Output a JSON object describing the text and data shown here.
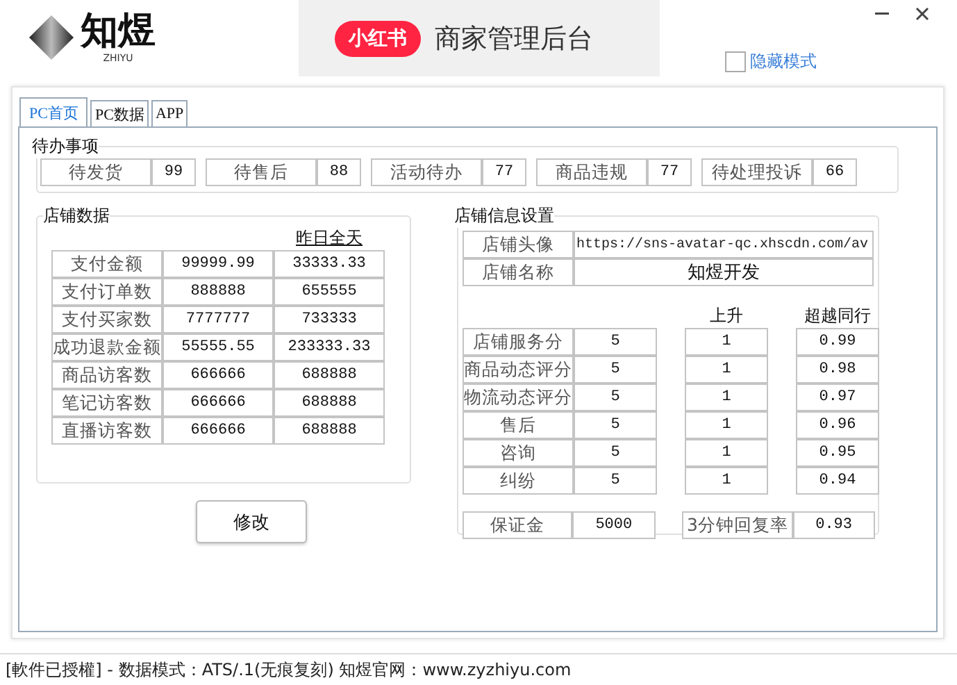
{
  "header": {
    "logo_text": "知煜",
    "logo_sub": "ZHIYU",
    "banner_badge": "小红书",
    "banner_title": "商家管理后台",
    "hide_mode": {
      "label": "隐藏模式",
      "checked": false
    }
  },
  "tabs": [
    {
      "label": "PC首页",
      "selected": true
    },
    {
      "label": "PC数据",
      "selected": false
    },
    {
      "label": "APP",
      "selected": false
    }
  ],
  "todo": {
    "title": "待办事项",
    "items": [
      {
        "label": "待发货",
        "count": "99"
      },
      {
        "label": "待售后",
        "count": "88"
      },
      {
        "label": "活动待办",
        "count": "77"
      },
      {
        "label": "商品违规",
        "count": "77"
      },
      {
        "label": "待处理投诉",
        "count": "66"
      }
    ]
  },
  "store_data": {
    "title": "店铺数据",
    "column_header": "昨日全天",
    "rows": [
      [
        "支付金额",
        "99999.99",
        "33333.33"
      ],
      [
        "支付订单数",
        "888888",
        "655555"
      ],
      [
        "支付买家数",
        "7777777",
        "733333"
      ],
      [
        "成功退款金额",
        "55555.55",
        "233333.33"
      ],
      [
        "商品访客数",
        "666666",
        "688888"
      ],
      [
        "笔记访客数",
        "666666",
        "688888"
      ],
      [
        "直播访客数",
        "666666",
        "688888"
      ]
    ]
  },
  "store_info": {
    "title": "店铺信息设置",
    "avatar": {
      "label": "店铺头像",
      "value": "https://sns-avatar-qc.xhscdn.com/av"
    },
    "name": {
      "label": "店铺名称",
      "value": "知煜开发"
    },
    "headers": [
      "上升",
      "超越同行"
    ],
    "scores": [
      [
        "店铺服务分",
        "5",
        "1",
        "0.99"
      ],
      [
        "商品动态评分",
        "5",
        "1",
        "0.98"
      ],
      [
        "物流动态评分",
        "5",
        "1",
        "0.97"
      ],
      [
        "售后",
        "5",
        "1",
        "0.96"
      ],
      [
        "咨询",
        "5",
        "1",
        "0.95"
      ],
      [
        "纠纷",
        "5",
        "1",
        "0.94"
      ]
    ],
    "deposit": {
      "label": "保证金",
      "value": "5000"
    },
    "reply": {
      "label": "3分钟回复率",
      "value": "0.93"
    }
  },
  "edit_button": "修改",
  "status_bar": "[軟件已授權] - 数据模式：ATS/.1(无痕复刻) 知煜官网：www.zyzhiyu.com"
}
